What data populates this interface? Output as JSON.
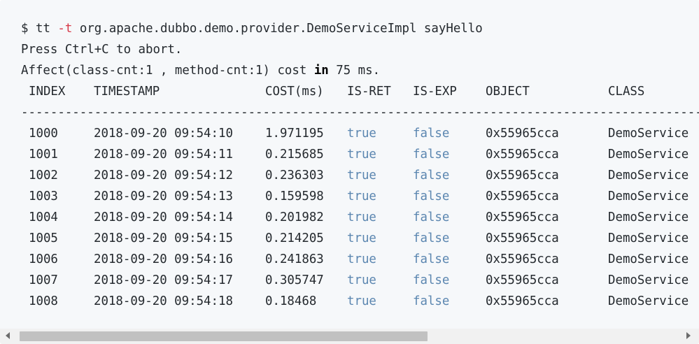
{
  "terminal": {
    "prompt_symbol": "$",
    "command_name": "tt",
    "command_flag": "-t",
    "command_args": "org.apache.dubbo.demo.provider.DemoServiceImpl sayHello",
    "abort_hint": "Press Ctrl+C to abort.",
    "affect_prefix": "Affect(class-cnt:1 , method-cnt:1) cost",
    "affect_keyword": "in",
    "affect_suffix": "75 ms."
  },
  "table": {
    "headers": [
      "INDEX",
      "TIMESTAMP",
      "COST(ms)",
      "IS-RET",
      "IS-EXP",
      "OBJECT",
      "CLASS"
    ],
    "separator": "---------------------------------------------------------------------------------------------------------------",
    "rows": [
      [
        "1000",
        "2018-09-20 09:54:10",
        "1.971195",
        "true",
        "false",
        "0x55965cca",
        "DemoService"
      ],
      [
        "1001",
        "2018-09-20 09:54:11",
        "0.215685",
        "true",
        "false",
        "0x55965cca",
        "DemoService"
      ],
      [
        "1002",
        "2018-09-20 09:54:12",
        "0.236303",
        "true",
        "false",
        "0x55965cca",
        "DemoService"
      ],
      [
        "1003",
        "2018-09-20 09:54:13",
        "0.159598",
        "true",
        "false",
        "0x55965cca",
        "DemoService"
      ],
      [
        "1004",
        "2018-09-20 09:54:14",
        "0.201982",
        "true",
        "false",
        "0x55965cca",
        "DemoService"
      ],
      [
        "1005",
        "2018-09-20 09:54:15",
        "0.214205",
        "true",
        "false",
        "0x55965cca",
        "DemoService"
      ],
      [
        "1006",
        "2018-09-20 09:54:16",
        "0.241863",
        "true",
        "false",
        "0x55965cca",
        "DemoService"
      ],
      [
        "1007",
        "2018-09-20 09:54:17",
        "0.305747",
        "true",
        "false",
        "0x55965cca",
        "DemoService"
      ],
      [
        "1008",
        "2018-09-20 09:54:18",
        "0.18468",
        "true",
        "false",
        "0x55965cca",
        "DemoService"
      ]
    ]
  },
  "scrollbar": {
    "left_arrow_icon": "triangle-left-icon",
    "right_arrow_icon": "triangle-right-icon",
    "thumb_fraction": 0.62
  }
}
